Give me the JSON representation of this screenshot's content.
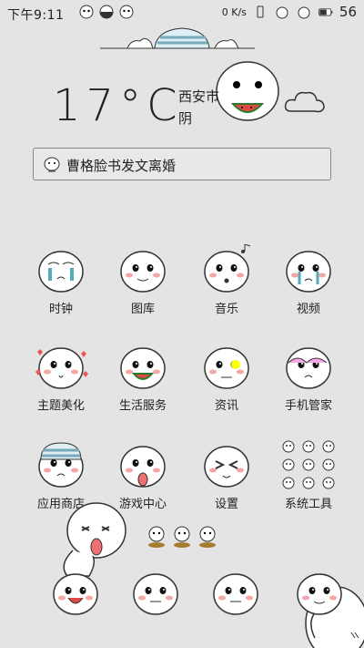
{
  "status_bar": {
    "time": "下午9:11",
    "speed": "0 K/s",
    "battery": "56"
  },
  "weather": {
    "temperature": "17°C",
    "city": "西安市",
    "condition": "阴"
  },
  "search": {
    "text": "曹格脸书发文离婚"
  },
  "apps": [
    {
      "label": "时钟",
      "icon": "clock-icon"
    },
    {
      "label": "图库",
      "icon": "gallery-icon"
    },
    {
      "label": "音乐",
      "icon": "music-icon"
    },
    {
      "label": "视频",
      "icon": "video-icon"
    },
    {
      "label": "主题美化",
      "icon": "theme-icon"
    },
    {
      "label": "生活服务",
      "icon": "life-service-icon"
    },
    {
      "label": "资讯",
      "icon": "news-icon"
    },
    {
      "label": "手机管家",
      "icon": "phone-manager-icon"
    },
    {
      "label": "应用商店",
      "icon": "app-store-icon"
    },
    {
      "label": "游戏中心",
      "icon": "game-center-icon"
    },
    {
      "label": "设置",
      "icon": "settings-icon"
    },
    {
      "label": "系统工具",
      "icon": "system-tools-icon"
    }
  ],
  "dock": [
    {
      "icon": "phone-icon"
    },
    {
      "icon": "contacts-icon"
    },
    {
      "icon": "messages-icon"
    },
    {
      "icon": "browser-icon"
    }
  ],
  "page_indicator": {
    "pages": 3
  }
}
